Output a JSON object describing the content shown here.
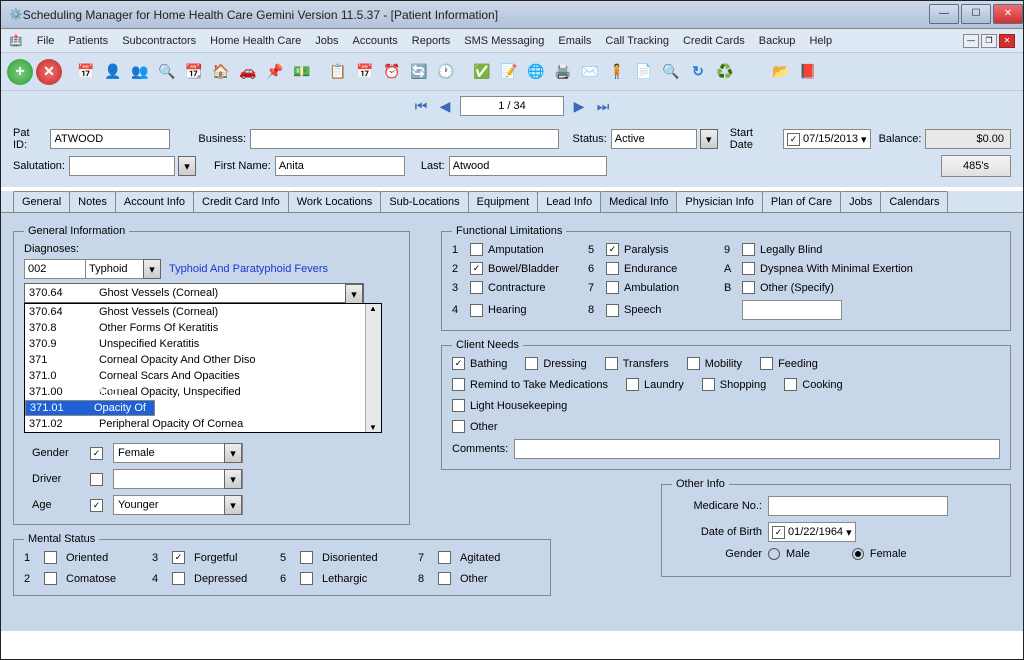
{
  "title": "Scheduling Manager for Home Health Care Gemini Version 11.5.37 - [Patient Information]",
  "menus": [
    "File",
    "Patients",
    "Subcontractors",
    "Home Health Care",
    "Jobs",
    "Accounts",
    "Reports",
    "SMS Messaging",
    "Emails",
    "Call Tracking",
    "Credit Cards",
    "Backup",
    "Help"
  ],
  "nav": {
    "page": "1 / 34"
  },
  "header": {
    "patid_label": "Pat ID:",
    "patid": "ATWOOD",
    "business_label": "Business:",
    "business": "",
    "status_label": "Status:",
    "status": "Active",
    "startdate_label": "Start Date",
    "startdate": "07/15/2013",
    "balance_label": "Balance:",
    "balance": "$0.00",
    "salutation_label": "Salutation:",
    "salutation": "",
    "firstname_label": "First Name:",
    "firstname": "Anita",
    "last_label": "Last:",
    "last": "Atwood",
    "btn485": "485's"
  },
  "tabs": [
    "General",
    "Notes",
    "Account Info",
    "Credit Card Info",
    "Work Locations",
    "Sub-Locations",
    "Equipment",
    "Lead Info",
    "Medical Info",
    "Physician Info",
    "Plan of Care",
    "Jobs",
    "Calendars"
  ],
  "active_tab": 8,
  "gi": {
    "legend": "General Information",
    "diag_label": "Diagnoses:",
    "diag_code": "002",
    "diag_name": "Typhoid",
    "diag_desc": "Typhoid And Paratyphoid Fevers",
    "dd_top": {
      "code": "370.64",
      "name": "Ghost Vessels (Corneal)"
    },
    "dd_rows": [
      {
        "code": "370.64",
        "name": "Ghost Vessels (Corneal)"
      },
      {
        "code": "370.8",
        "name": "Other Forms Of Keratitis"
      },
      {
        "code": "370.9",
        "name": "Unspecified Keratitis"
      },
      {
        "code": "371",
        "name": "Corneal Opacity And Other Diso"
      },
      {
        "code": "371.0",
        "name": "Corneal Scars And Opacities"
      },
      {
        "code": "371.00",
        "name": "Corneal Opacity, Unspecified"
      },
      {
        "code": "371.01",
        "name": "Minor Opacity Of Cornea",
        "sel": true
      },
      {
        "code": "371.02",
        "name": "Peripheral Opacity Of Cornea"
      }
    ],
    "gender_label": "Gender",
    "gender_chk": true,
    "gender_val": "Female",
    "driver_label": "Driver",
    "driver_chk": false,
    "driver_val": "",
    "age_label": "Age",
    "age_chk": true,
    "age_val": "Younger"
  },
  "fl": {
    "legend": "Functional Limitations",
    "items": [
      {
        "n": "1",
        "label": "Amputation",
        "chk": false
      },
      {
        "n": "5",
        "label": "Paralysis",
        "chk": true
      },
      {
        "n": "9",
        "label": "Legally Blind",
        "chk": false
      },
      {
        "n": "2",
        "label": "Bowel/Bladder",
        "chk": true
      },
      {
        "n": "6",
        "label": "Endurance",
        "chk": false
      },
      {
        "n": "A",
        "label": "Dyspnea With Minimal Exertion",
        "chk": false
      },
      {
        "n": "3",
        "label": "Contracture",
        "chk": false
      },
      {
        "n": "7",
        "label": "Ambulation",
        "chk": false
      },
      {
        "n": "B",
        "label": "Other (Specify)",
        "chk": false
      },
      {
        "n": "4",
        "label": "Hearing",
        "chk": false
      },
      {
        "n": "8",
        "label": "Speech",
        "chk": false
      }
    ],
    "other_val": ""
  },
  "cn": {
    "legend": "Client Needs",
    "row1": [
      {
        "l": "Bathing",
        "c": true
      },
      {
        "l": "Dressing",
        "c": false
      },
      {
        "l": "Transfers",
        "c": false
      },
      {
        "l": "Mobility",
        "c": false
      },
      {
        "l": "Feeding",
        "c": false
      }
    ],
    "row2": [
      {
        "l": "Remind to Take Medications",
        "c": false
      },
      {
        "l": "Laundry",
        "c": false
      },
      {
        "l": "Shopping",
        "c": false
      },
      {
        "l": "Cooking",
        "c": false
      }
    ],
    "row3": [
      {
        "l": "Light Housekeeping",
        "c": false
      }
    ],
    "row4": [
      {
        "l": "Other",
        "c": false
      }
    ],
    "comments_label": "Comments:",
    "comments": ""
  },
  "ms": {
    "legend": "Mental Status",
    "items": [
      {
        "n": "1",
        "l": "Oriented",
        "c": false
      },
      {
        "n": "3",
        "l": "Forgetful",
        "c": true
      },
      {
        "n": "5",
        "l": "Disoriented",
        "c": false
      },
      {
        "n": "7",
        "l": "Agitated",
        "c": false
      },
      {
        "n": "2",
        "l": "Comatose",
        "c": false
      },
      {
        "n": "4",
        "l": "Depressed",
        "c": false
      },
      {
        "n": "6",
        "l": "Lethargic",
        "c": false
      },
      {
        "n": "8",
        "l": "Other",
        "c": false
      }
    ],
    "other_val": ""
  },
  "oi": {
    "legend": "Other Info",
    "medicare_label": "Medicare No.:",
    "medicare": "",
    "dob_label": "Date of Birth",
    "dob": "01/22/1964",
    "gender_label": "Gender",
    "male": "Male",
    "female": "Female",
    "gender_val": "Female"
  }
}
